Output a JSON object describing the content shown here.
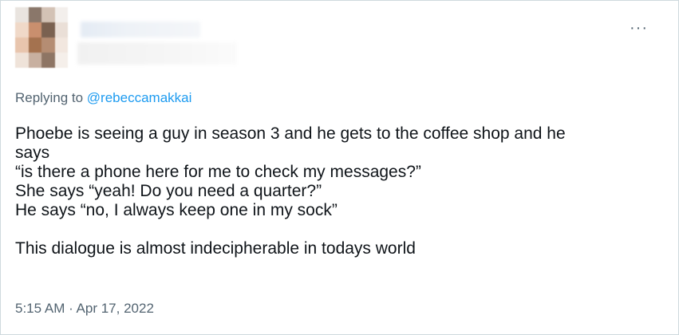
{
  "author": {
    "avatar_colors": [
      "#e9e4df",
      "#8a776a",
      "#d3c2b5",
      "#f3efec",
      "#f0d9c8",
      "#c98f6e",
      "#7a6150",
      "#eadfd7",
      "#e8c5ad",
      "#a4724f",
      "#b58d73",
      "#f2e7df",
      "#efe3d9",
      "#c8b0a0",
      "#8e7564",
      "#f5efea"
    ]
  },
  "menu": {
    "more_label": "···"
  },
  "reply": {
    "prefix": "Replying to",
    "handle": "@rebeccamakkai"
  },
  "tweet": {
    "lines": [
      "Phoebe is seeing a guy in season 3 and he gets to the coffee shop and he",
      "says",
      "“is there a phone here for me to check my messages?”",
      "She says “yeah! Do you need a quarter?”",
      "He says “no, I always keep one in my sock”",
      "",
      "This dialogue is almost indecipherable in todays world"
    ]
  },
  "meta": {
    "timestamp": "5:15 AM · Apr 17, 2022"
  },
  "colors": {
    "link": "#1d9bf0",
    "secondary_text": "#536471",
    "primary_text": "#0f1419",
    "border": "#cfd9de"
  }
}
